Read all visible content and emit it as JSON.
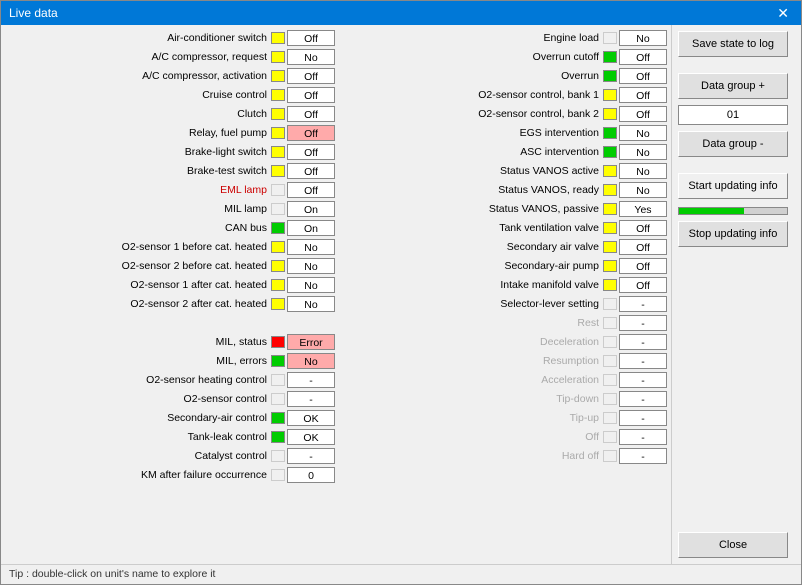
{
  "window": {
    "title": "Live data",
    "close_label": "✕"
  },
  "bottom_tip": "Tip : double-click on unit's name to explore it",
  "right_panel": {
    "save_state_label": "Save state to log",
    "data_group_plus_label": "Data group +",
    "group_number": "01",
    "data_group_minus_label": "Data group -",
    "start_updating_label": "Start updating info",
    "stop_updating_label": "Stop updating info",
    "close_label": "Close"
  },
  "left_column": [
    {
      "label": "Air-conditioner switch",
      "indicator": "yellow",
      "value": "Off",
      "value_style": ""
    },
    {
      "label": "A/C compressor, request",
      "indicator": "yellow",
      "value": "No",
      "value_style": ""
    },
    {
      "label": "A/C compressor, activation",
      "indicator": "yellow",
      "value": "Off",
      "value_style": ""
    },
    {
      "label": "Cruise control",
      "indicator": "yellow",
      "value": "Off",
      "value_style": ""
    },
    {
      "label": "Clutch",
      "indicator": "yellow",
      "value": "Off",
      "value_style": ""
    },
    {
      "label": "Relay, fuel pump",
      "indicator": "yellow",
      "value": "Off",
      "value_style": "red-bg"
    },
    {
      "label": "Brake-light switch",
      "indicator": "yellow",
      "value": "Off",
      "value_style": ""
    },
    {
      "label": "Brake-test switch",
      "indicator": "yellow",
      "value": "Off",
      "value_style": ""
    },
    {
      "label": "EML lamp",
      "indicator": "empty",
      "value": "Off",
      "value_style": "",
      "label_red": true
    },
    {
      "label": "MIL lamp",
      "indicator": "empty",
      "value": "On",
      "value_style": ""
    },
    {
      "label": "CAN bus",
      "indicator": "green",
      "value": "On",
      "value_style": ""
    },
    {
      "label": "O2-sensor 1 before cat. heated",
      "indicator": "yellow",
      "value": "No",
      "value_style": ""
    },
    {
      "label": "O2-sensor 2 before cat. heated",
      "indicator": "yellow",
      "value": "No",
      "value_style": ""
    },
    {
      "label": "O2-sensor 1 after cat. heated",
      "indicator": "yellow",
      "value": "No",
      "value_style": ""
    },
    {
      "label": "O2-sensor 2 after cat. heated",
      "indicator": "yellow",
      "value": "No",
      "value_style": ""
    },
    {
      "label": "",
      "indicator": "empty",
      "value": "",
      "value_style": "empty-val",
      "spacer": true
    },
    {
      "label": "MIL, status",
      "indicator": "red",
      "value": "Error",
      "value_style": "red-bg"
    },
    {
      "label": "MIL, errors",
      "indicator": "green",
      "value": "No",
      "value_style": "red-bg"
    },
    {
      "label": "O2-sensor heating control",
      "indicator": "empty",
      "value": "-",
      "value_style": ""
    },
    {
      "label": "O2-sensor control",
      "indicator": "empty",
      "value": "-",
      "value_style": ""
    },
    {
      "label": "Secondary-air control",
      "indicator": "green",
      "value": "OK",
      "value_style": ""
    },
    {
      "label": "Tank-leak control",
      "indicator": "green",
      "value": "OK",
      "value_style": ""
    },
    {
      "label": "Catalyst control",
      "indicator": "empty",
      "value": "-",
      "value_style": ""
    },
    {
      "label": "KM after failure occurrence",
      "indicator": "empty",
      "value": "0",
      "value_style": ""
    }
  ],
  "right_column": [
    {
      "label": "Engine load",
      "indicator": "empty",
      "value": "No",
      "value_style": ""
    },
    {
      "label": "Overrun cutoff",
      "indicator": "green",
      "value": "Off",
      "value_style": ""
    },
    {
      "label": "Overrun",
      "indicator": "green",
      "value": "Off",
      "value_style": ""
    },
    {
      "label": "O2-sensor control, bank 1",
      "indicator": "yellow",
      "value": "Off",
      "value_style": ""
    },
    {
      "label": "O2-sensor control, bank 2",
      "indicator": "yellow",
      "value": "Off",
      "value_style": ""
    },
    {
      "label": "EGS intervention",
      "indicator": "green",
      "value": "No",
      "value_style": ""
    },
    {
      "label": "ASC intervention",
      "indicator": "green",
      "value": "No",
      "value_style": ""
    },
    {
      "label": "Status VANOS active",
      "indicator": "yellow",
      "value": "No",
      "value_style": ""
    },
    {
      "label": "Status VANOS, ready",
      "indicator": "yellow",
      "value": "No",
      "value_style": ""
    },
    {
      "label": "Status VANOS, passive",
      "indicator": "yellow",
      "value": "Yes",
      "value_style": ""
    },
    {
      "label": "Tank ventilation valve",
      "indicator": "yellow",
      "value": "Off",
      "value_style": ""
    },
    {
      "label": "Secondary air valve",
      "indicator": "yellow",
      "value": "Off",
      "value_style": ""
    },
    {
      "label": "Secondary-air pump",
      "indicator": "yellow",
      "value": "Off",
      "value_style": ""
    },
    {
      "label": "Intake manifold valve",
      "indicator": "yellow",
      "value": "Off",
      "value_style": ""
    },
    {
      "label": "Selector-lever setting",
      "indicator": "empty",
      "value": "-",
      "value_style": ""
    },
    {
      "label": "Rest",
      "indicator": "empty",
      "value": "-",
      "value_style": "",
      "label_faded": true
    },
    {
      "label": "Deceleration",
      "indicator": "empty",
      "value": "-",
      "value_style": "",
      "label_faded": true
    },
    {
      "label": "Resumption",
      "indicator": "empty",
      "value": "-",
      "value_style": "",
      "label_faded": true
    },
    {
      "label": "Acceleration",
      "indicator": "empty",
      "value": "-",
      "value_style": "",
      "label_faded": true
    },
    {
      "label": "Tip-down",
      "indicator": "empty",
      "value": "-",
      "value_style": "",
      "label_faded": true
    },
    {
      "label": "Tip-up",
      "indicator": "empty",
      "value": "-",
      "value_style": "",
      "label_faded": true
    },
    {
      "label": "Off",
      "indicator": "empty",
      "value": "-",
      "value_style": "",
      "label_faded": true
    },
    {
      "label": "Hard off",
      "indicator": "empty",
      "value": "-",
      "value_style": "",
      "label_faded": true
    }
  ]
}
